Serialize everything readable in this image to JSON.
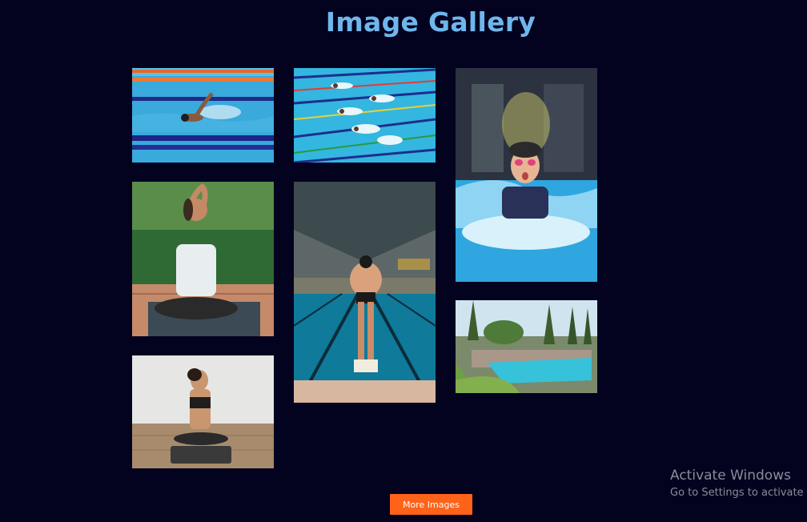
{
  "header": {
    "title": "Image Gallery"
  },
  "gallery": {
    "images": [
      {
        "subject": "swimmer freestyle in lane"
      },
      {
        "subject": "swimmers racing in lanes"
      },
      {
        "subject": "child splashing in pool with goggles"
      },
      {
        "subject": "woman yoga pose outdoors"
      },
      {
        "subject": "swimmer on starting block indoor pool"
      },
      {
        "subject": "outdoor pool with trees"
      },
      {
        "subject": "woman seated meditation on mat"
      }
    ]
  },
  "actions": {
    "more_label": "More Images"
  },
  "watermark": {
    "title": "Activate Windows",
    "subtitle": "Go to Settings to activate"
  },
  "colors": {
    "background": "#03021f",
    "title": "#6fb6ec",
    "button": "#ff6219"
  }
}
